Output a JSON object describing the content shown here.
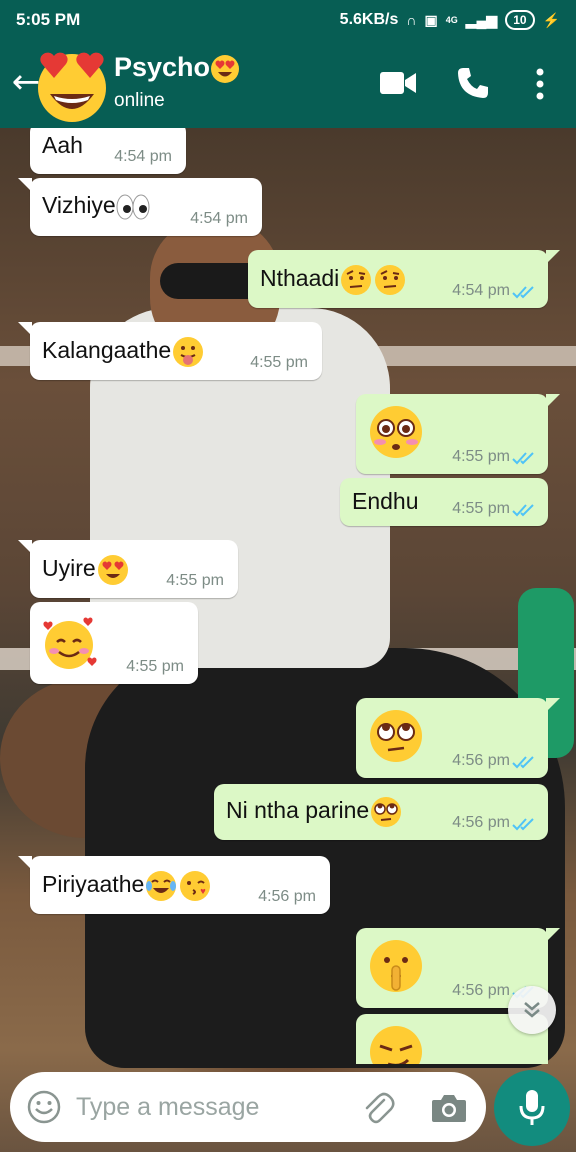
{
  "status_bar": {
    "time": "5:05 PM",
    "speed": "5.6KB/s",
    "network": "4G",
    "battery": "10"
  },
  "header": {
    "name": "Psycho",
    "status": "online"
  },
  "messages": [
    {
      "dir": "in",
      "text": "Aah",
      "emoji": [],
      "time": "4:54 pm"
    },
    {
      "dir": "in",
      "text": "Vizhiye",
      "emoji": [
        "eyes"
      ],
      "time": "4:54 pm"
    },
    {
      "dir": "out",
      "text": "Nthaadi",
      "emoji": [
        "raised-eyebrow",
        "raised-eyebrow"
      ],
      "time": "4:54 pm",
      "status": "read"
    },
    {
      "dir": "in",
      "text": "Kalangaathe",
      "emoji": [
        "tongue-out"
      ],
      "time": "4:55 pm"
    },
    {
      "dir": "out",
      "text": "",
      "emoji": [
        "flushed"
      ],
      "time": "4:55 pm",
      "status": "read"
    },
    {
      "dir": "out",
      "text": "Endhu",
      "emoji": [],
      "time": "4:55 pm",
      "status": "read"
    },
    {
      "dir": "in",
      "text": "Uyire",
      "emoji": [
        "heart-eyes"
      ],
      "time": "4:55 pm"
    },
    {
      "dir": "in",
      "text": "",
      "emoji": [
        "smiling-with-hearts"
      ],
      "time": "4:55 pm"
    },
    {
      "dir": "out",
      "text": "",
      "emoji": [
        "eye-roll"
      ],
      "time": "4:56 pm",
      "status": "read"
    },
    {
      "dir": "out",
      "text": "Ni ntha parine",
      "emoji": [
        "eye-roll"
      ],
      "time": "4:56 pm",
      "status": "read"
    },
    {
      "dir": "in",
      "text": "Piriyaathe",
      "emoji": [
        "tears-of-joy",
        "kissing"
      ],
      "time": "4:56 pm"
    },
    {
      "dir": "out",
      "text": "",
      "emoji": [
        "shushing"
      ],
      "time": "4:56 pm",
      "status": "read"
    },
    {
      "dir": "out",
      "text": "",
      "emoji": [
        "smirk"
      ],
      "time": "",
      "status": ""
    }
  ],
  "composer": {
    "placeholder": "Type a message"
  },
  "colors": {
    "header": "#075E54",
    "outgoing_bubble": "#DCF8C6",
    "incoming_bubble": "#FFFFFF",
    "read_ticks": "#4FC3F7",
    "mic_button": "#128C7E"
  }
}
